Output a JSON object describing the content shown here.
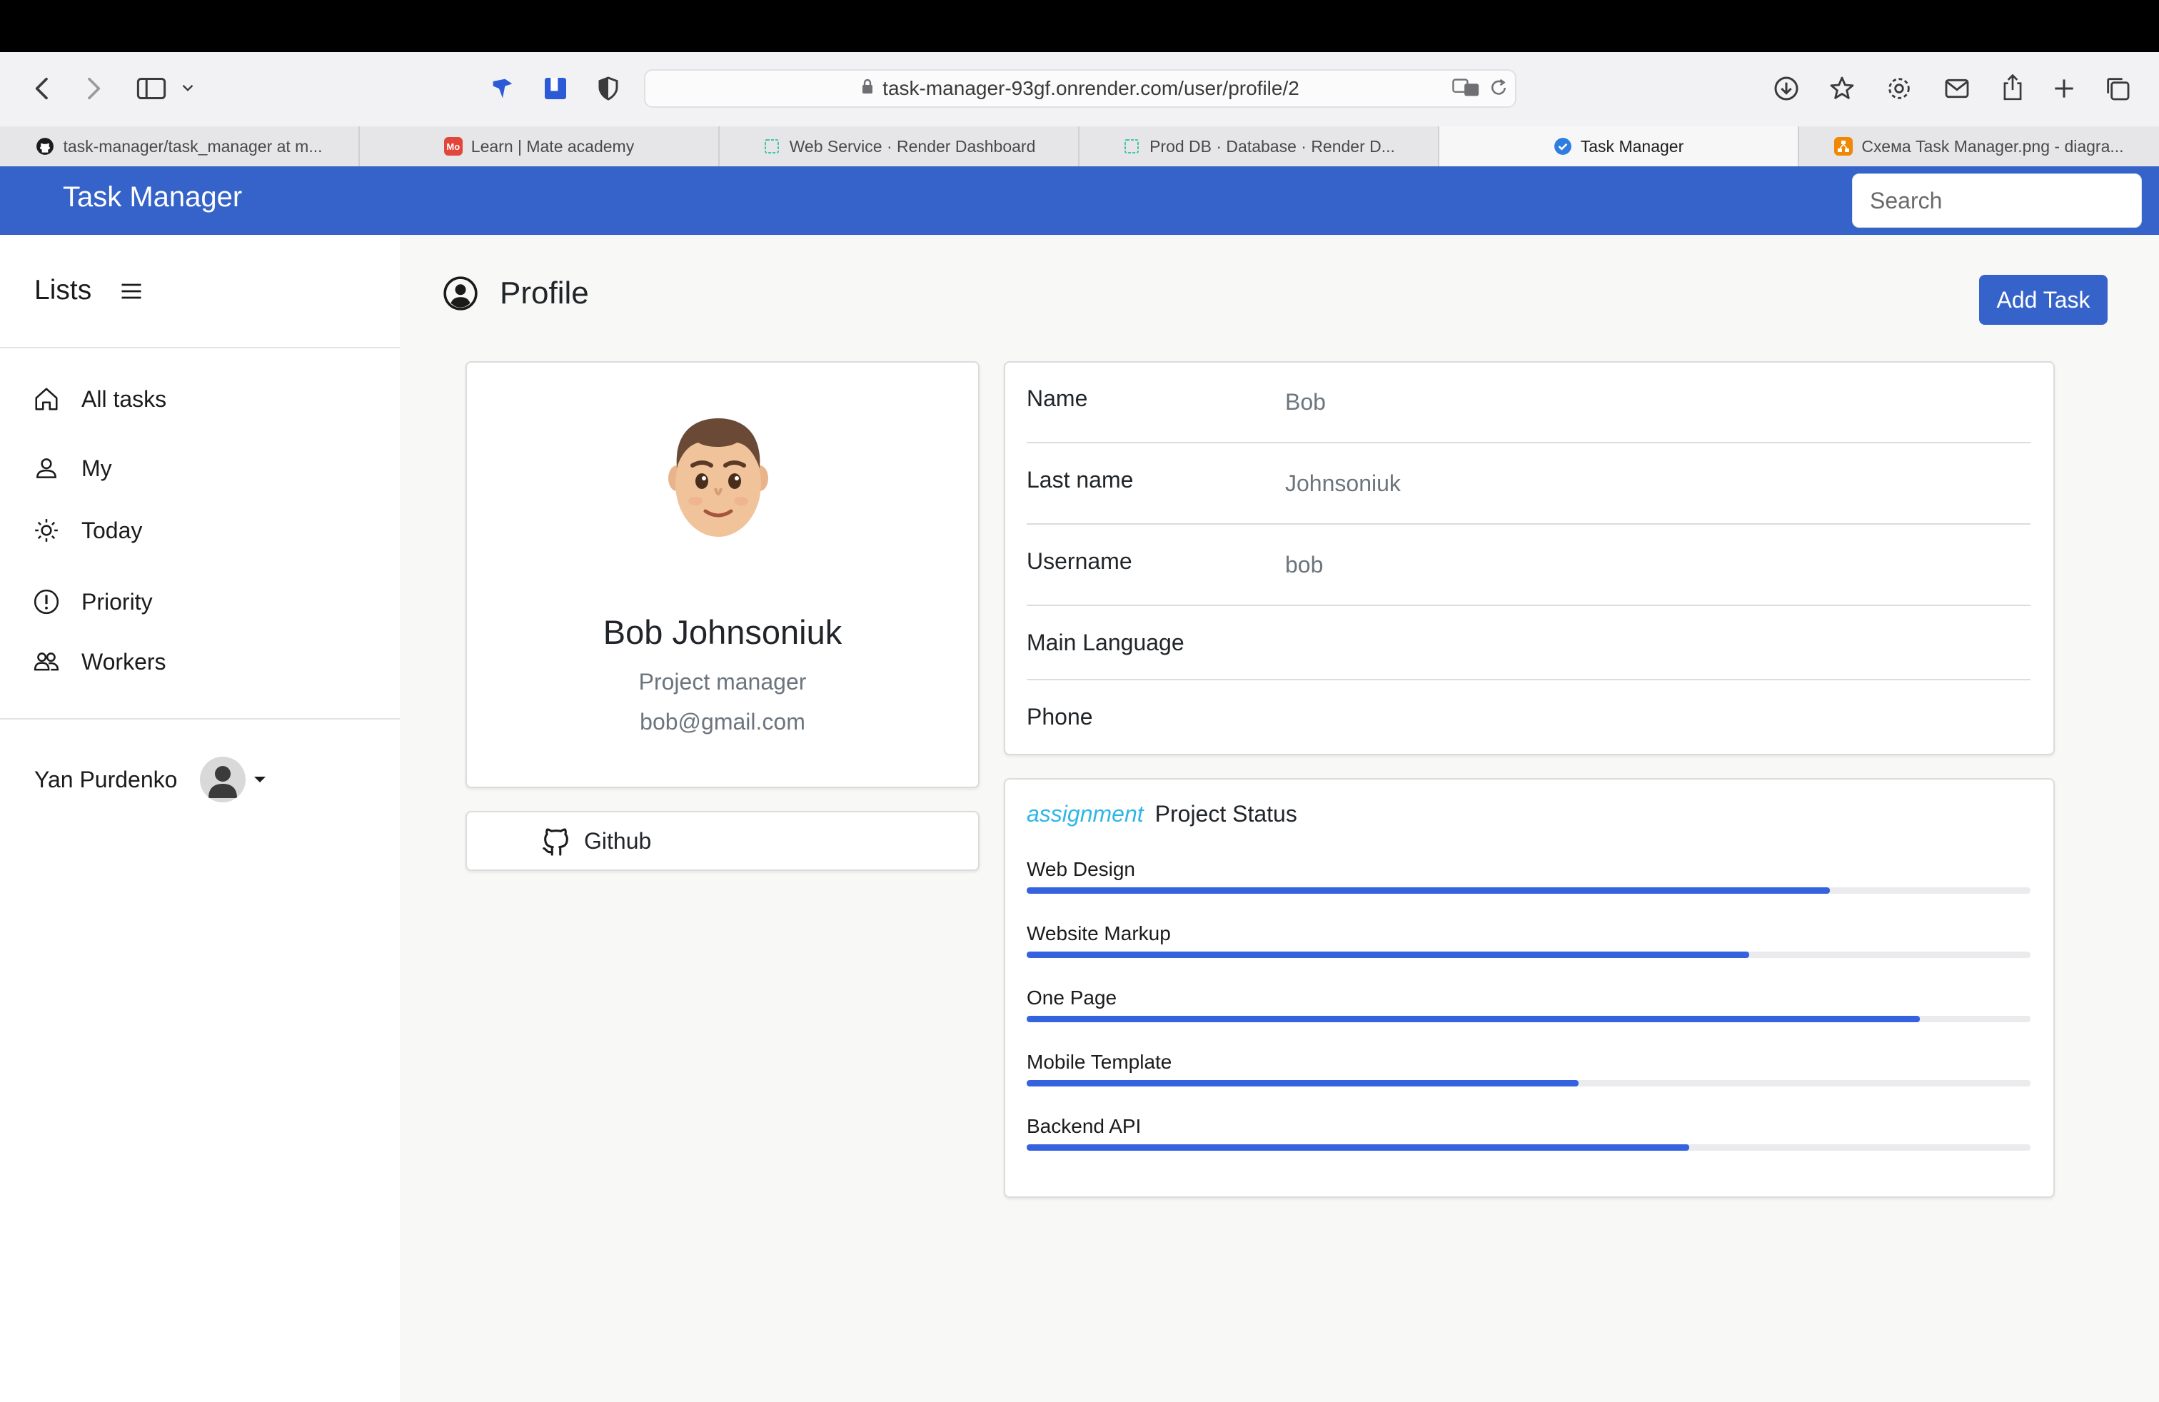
{
  "browser": {
    "url": "task-manager-93gf.onrender.com/user/profile/2",
    "tabs": [
      {
        "label": "task-manager/task_manager at m...",
        "icon": "github-icon",
        "active": false
      },
      {
        "label": "Learn | Mate academy",
        "icon": "mate-academy-icon",
        "active": false
      },
      {
        "label": "Web Service  ·  Render Dashboard",
        "icon": "render-icon",
        "active": false
      },
      {
        "label": "Prod DB  ·  Database  ·  Render D...",
        "icon": "render-icon",
        "active": false
      },
      {
        "label": "Task Manager",
        "icon": "check-circle-icon",
        "active": true
      },
      {
        "label": "Схема Task Manager.png - diagra...",
        "icon": "drawio-icon",
        "active": false
      }
    ]
  },
  "navbar": {
    "brand": "Task Manager",
    "search_placeholder": "Search",
    "color": "#3563c9"
  },
  "sidebar": {
    "title": "Lists",
    "items": [
      {
        "label": "All tasks",
        "icon": "home-icon"
      },
      {
        "label": "My",
        "icon": "user-icon"
      },
      {
        "label": "Today",
        "icon": "sun-icon"
      },
      {
        "label": "Priority",
        "icon": "exclamation-circle-icon"
      },
      {
        "label": "Workers",
        "icon": "people-icon"
      }
    ],
    "user_name": "Yan Purdenko"
  },
  "main": {
    "heading": "Profile",
    "add_task_label": "Add Task",
    "profile": {
      "full_name": "Bob Johnsoniuk",
      "role": "Project manager",
      "email": "bob@gmail.com",
      "github_label": "Github"
    },
    "info": [
      {
        "label": "Name",
        "value": "Bob"
      },
      {
        "label": "Last name",
        "value": "Johnsoniuk"
      },
      {
        "label": "Username",
        "value": "bob"
      },
      {
        "label": "Main Language",
        "value": ""
      },
      {
        "label": "Phone",
        "value": ""
      }
    ],
    "status": {
      "icon_text": "assignment",
      "title": "Project Status",
      "projects": [
        {
          "label": "Web Design",
          "progress": 0.8
        },
        {
          "label": "Website Markup",
          "progress": 0.72
        },
        {
          "label": "One Page",
          "progress": 0.89
        },
        {
          "label": "Mobile Template",
          "progress": 0.55
        },
        {
          "label": "Backend API",
          "progress": 0.66
        }
      ]
    }
  }
}
